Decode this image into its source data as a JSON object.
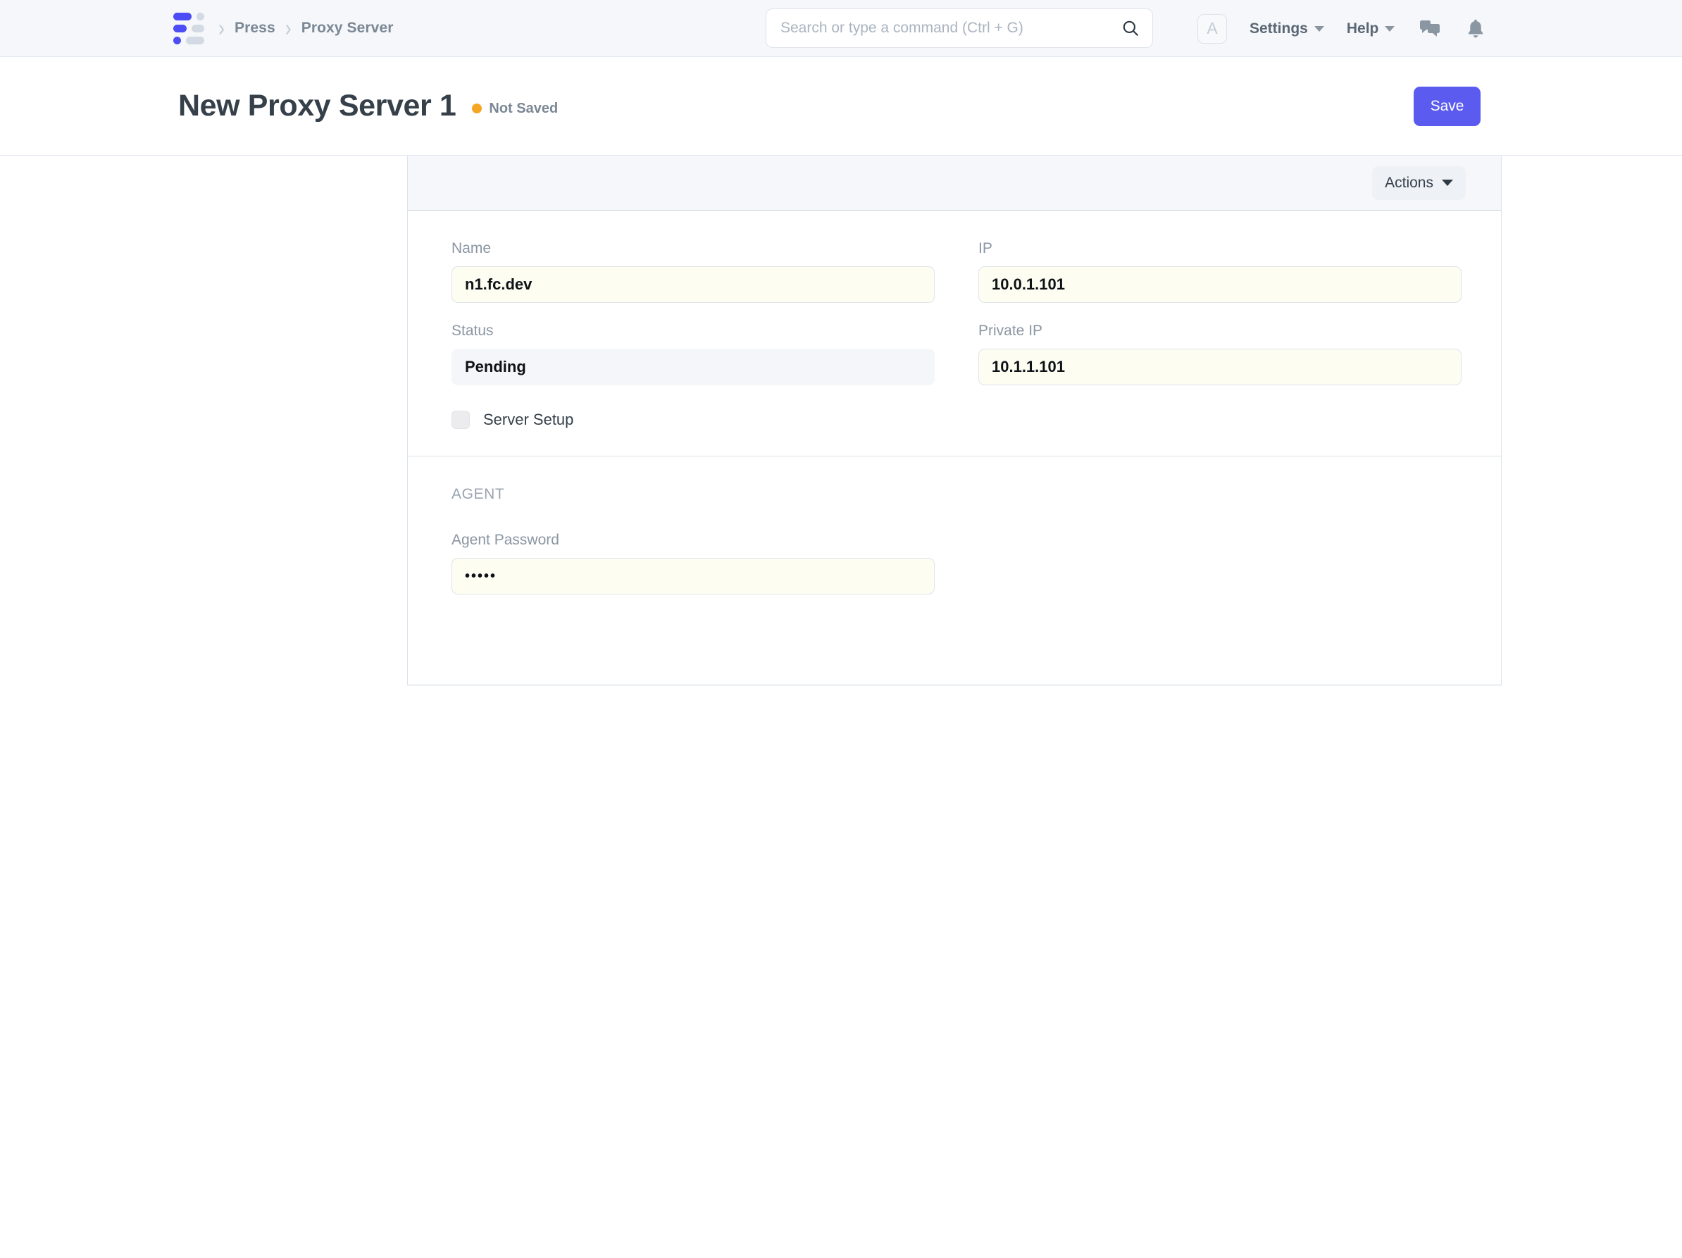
{
  "nav": {
    "logo_name": "frappe-press-logo",
    "breadcrumbs": [
      {
        "label": "Press"
      },
      {
        "label": "Proxy Server"
      }
    ],
    "search": {
      "placeholder": "Search or type a command (Ctrl + G)",
      "value": "",
      "icon": "search-icon"
    },
    "avatar_initial": "A",
    "menus": [
      {
        "label": "Settings",
        "icon": "chevron-down-icon"
      },
      {
        "label": "Help",
        "icon": "chevron-down-icon"
      }
    ],
    "icons": [
      {
        "name": "chat-bubbles-icon"
      },
      {
        "name": "bell-icon"
      }
    ]
  },
  "title_bar": {
    "title": "New Proxy Server 1",
    "status_label": "Not Saved",
    "status_color": "#f5a623",
    "save_label": "Save",
    "save_color": "#5b5bf0"
  },
  "card": {
    "actions_label": "Actions",
    "fields": [
      {
        "label": "Name",
        "value": "n1.fc.dev",
        "type": "text",
        "modified": true
      },
      {
        "label": "IP",
        "value": "10.0.1.101",
        "type": "text",
        "modified": true
      },
      {
        "label": "Status",
        "value": "Pending",
        "type": "readonly",
        "modified": false
      },
      {
        "label": "Private IP",
        "value": "10.1.1.101",
        "type": "text",
        "modified": true
      }
    ],
    "checkbox": {
      "label": "Server Setup",
      "checked": false
    },
    "agent_section": {
      "title": "AGENT",
      "password_label": "Agent Password",
      "password_mask": "•••••"
    }
  }
}
